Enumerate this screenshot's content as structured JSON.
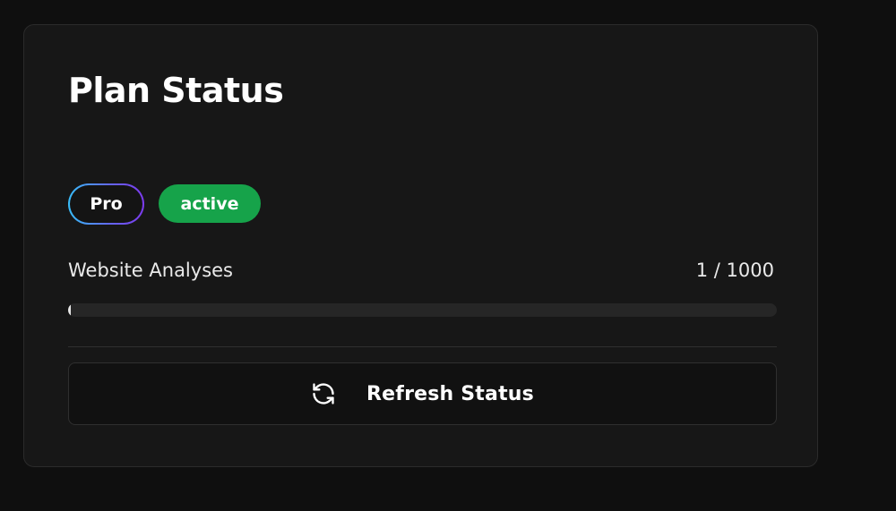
{
  "card": {
    "title": "Plan Status",
    "plan_badge": "Pro",
    "status_badge": "active",
    "usage": {
      "label": "Website Analyses",
      "value_text": "1 / 1000",
      "used": 1,
      "limit": 1000
    },
    "refresh_button": {
      "label": "Refresh Status",
      "icon": "refresh-icon"
    }
  },
  "colors": {
    "background": "#0f0f0f",
    "card": "#171717",
    "status_active": "#16a34a",
    "pro_gradient_start": "#38bdf8",
    "pro_gradient_end": "#7c3aed"
  }
}
